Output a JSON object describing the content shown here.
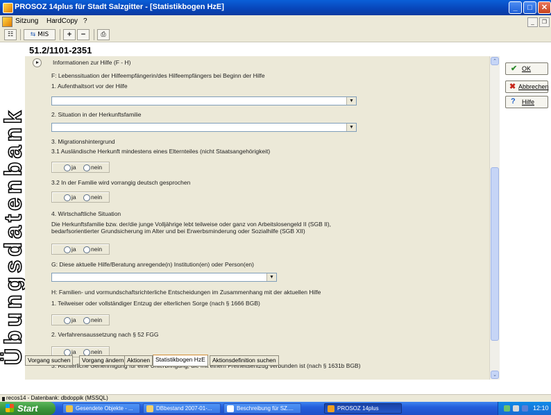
{
  "window": {
    "title": "PROSOZ 14plus für Stadt Salzgitter - [Statistikbogen HzE]",
    "buttons": [
      "_",
      "□",
      "✕"
    ]
  },
  "menu": {
    "items": [
      "Sitzung",
      "HardCopy",
      "?"
    ]
  },
  "toolbar": {
    "mis_label": "MIS"
  },
  "record_id": "51.2/1101-2351",
  "watermark": "Übungsdatenbank",
  "form": {
    "section_header": "Informationen zur Hilfe (F - H)",
    "f_title": "F: Lebenssituation der Hilfeempfängerin/des Hilfeempfängers bei Beginn der Hilfe",
    "q1": "1. Aufenthaltsort vor der Hilfe",
    "q2": "2. Situation in der Herkunftsfamilie",
    "q3": "3. Migrationshintergrund",
    "q31": "3.1 Ausländische Herkunft mindestens eines Elternteiles (nicht Staatsangehörigkeit)",
    "q32": "3.2 In der Familie wird vorrangig deutsch gesprochen",
    "q4": "4. Wirtschaftliche Situation",
    "q4_text_1": "Die Herkunftsfamilie bzw. der/die junge Volljährige lebt teilweise oder ganz von Arbeitslosengeld II (SGB II),",
    "q4_text_2": "bedarfsorientierter Grundsicherung im Alter und bei Erwerbsminderung oder Sozialhilfe (SGB XII)",
    "g_title": "G: Diese aktuelle Hilfe/Beratung anregende(n) Institution(en) oder Person(en)",
    "h_title": "H: Familien- und vormundschaftsrichterliche Entscheidungen im Zusammenhang mit der aktuellen Hilfe",
    "h1": "1. Teilweiser oder vollständiger Entzug der elterlichen Sorge (nach § 1666 BGB)",
    "h2": "2. Verfahrensaussetzung nach § 52 FGG",
    "h3": "3. Richterliche Genehmigung für eine Unterbringung, die mit einem Freiheitsentzug verbunden ist (nach § 1631b BGB)",
    "ja": "ja",
    "nein": "nein"
  },
  "side_buttons": {
    "ok": "OK",
    "cancel": "Abbrechen",
    "help": "Hilfe"
  },
  "tabs": [
    "Vorgang suchen",
    "Vorgang ändern",
    "Aktionen",
    "Statistikbogen HzE",
    "Aktionsdefinition suchen"
  ],
  "active_tab": "Statistikbogen HzE",
  "status": "recos14 - Datenbank: dbdoppik (MSSQL)",
  "taskbar": {
    "start": "Start",
    "tasks": [
      "Gesendete Objekte - ...",
      "DBbestand 2007-01-...",
      "Beschreibung für SZ....",
      "PROSOZ 14plus"
    ],
    "clock": "12:10"
  }
}
